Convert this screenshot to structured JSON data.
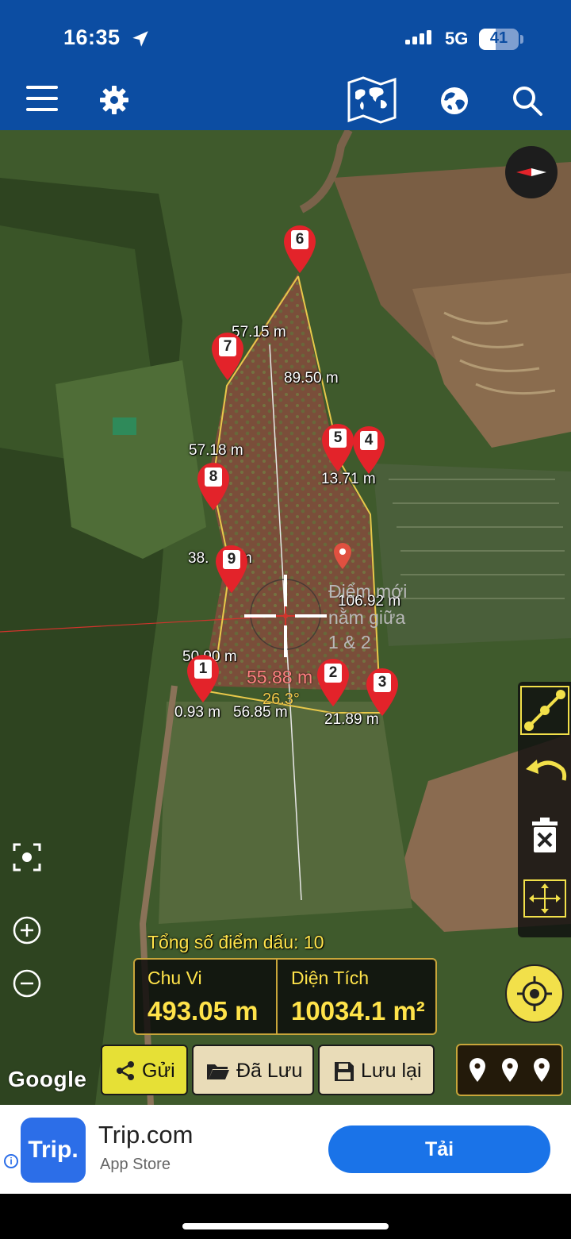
{
  "status_bar": {
    "time": "16:35",
    "network": "5G",
    "battery": "41"
  },
  "toolbar": {
    "menu_icon": "hamburger-menu-icon",
    "settings_icon": "gear-icon",
    "map_icon": "world-map-icon",
    "globe_icon": "globe-icon",
    "search_icon": "search-icon"
  },
  "map": {
    "markers": [
      {
        "num": "1"
      },
      {
        "num": "2"
      },
      {
        "num": "3"
      },
      {
        "num": "4"
      },
      {
        "num": "5"
      },
      {
        "num": "6"
      },
      {
        "num": "7"
      },
      {
        "num": "8"
      },
      {
        "num": "9"
      }
    ],
    "segment_labels": [
      "57.15 m",
      "89.50 m",
      "57.18 m",
      "13.71 m",
      "38.",
      "m",
      "106.92 m",
      "50.90 m",
      "0.93 m",
      "56.85 m",
      "21.89 m"
    ],
    "live_distance": "55.88 m",
    "live_angle": "26.3°",
    "new_point_hint": [
      "Điểm mới",
      "nằm giữa",
      "1 & 2"
    ],
    "total_points_label": "Tổng số điểm dấu:",
    "total_points_value": "10",
    "perimeter_label": "Chu Vi",
    "perimeter_value": "493.05 m",
    "area_label": "Diện Tích",
    "area_value": "10034.1 m²",
    "attribution": "Google"
  },
  "actions": {
    "send_label": "Gửi",
    "saved_label": "Đã Lưu",
    "save_label": "Lưu lại"
  },
  "colors": {
    "app_bar": "#0c4da2",
    "accent_yellow": "#f2e04a",
    "marker_red": "#e3232a",
    "polygon_line": "#e8c84a"
  },
  "ad": {
    "logo_text": "Trip.",
    "title": "Trip.com",
    "subtitle": "App Store",
    "cta": "Tải"
  }
}
